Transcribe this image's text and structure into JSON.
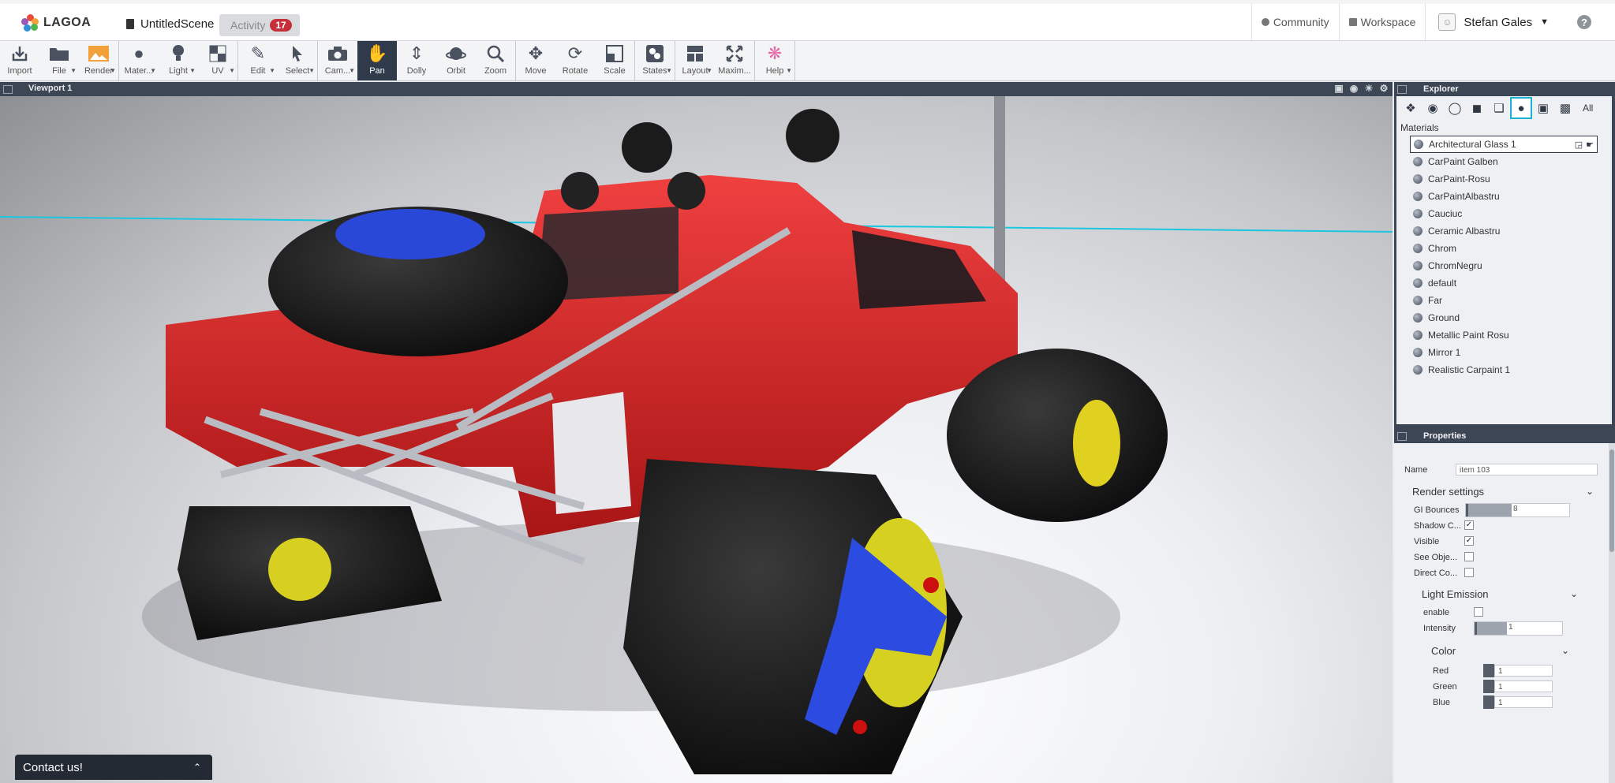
{
  "app": {
    "logo_text": "LAGOA",
    "scene_name": "UntitledScene",
    "activity_label": "Activity",
    "activity_count": "17"
  },
  "topnav": {
    "community": "Community",
    "workspace": "Workspace",
    "user_name": "Stefan Gales",
    "help": "?"
  },
  "toolbar": [
    {
      "id": "import",
      "label": "Import",
      "icon": "import-icon"
    },
    {
      "id": "file",
      "label": "File",
      "icon": "folder-icon"
    },
    {
      "id": "render",
      "label": "Render",
      "icon": "render-icon"
    },
    {
      "id": "material",
      "label": "Mater...",
      "icon": "material-icon"
    },
    {
      "id": "light",
      "label": "Light",
      "icon": "light-icon"
    },
    {
      "id": "uv",
      "label": "UV",
      "icon": "uv-icon"
    },
    {
      "id": "edit",
      "label": "Edit",
      "icon": "edit-icon"
    },
    {
      "id": "select",
      "label": "Select",
      "icon": "select-icon"
    },
    {
      "id": "camera",
      "label": "Cam...",
      "icon": "camera-icon"
    },
    {
      "id": "pan",
      "label": "Pan",
      "icon": "pan-icon"
    },
    {
      "id": "dolly",
      "label": "Dolly",
      "icon": "dolly-icon"
    },
    {
      "id": "orbit",
      "label": "Orbit",
      "icon": "orbit-icon"
    },
    {
      "id": "zoom",
      "label": "Zoom",
      "icon": "zoom-icon"
    },
    {
      "id": "move",
      "label": "Move",
      "icon": "move-icon"
    },
    {
      "id": "rotate",
      "label": "Rotate",
      "icon": "rotate-icon"
    },
    {
      "id": "scale",
      "label": "Scale",
      "icon": "scale-icon"
    },
    {
      "id": "states",
      "label": "States",
      "icon": "states-icon"
    },
    {
      "id": "layout",
      "label": "Layout",
      "icon": "layout-icon"
    },
    {
      "id": "maximize",
      "label": "Maxim...",
      "icon": "maximize-icon"
    },
    {
      "id": "help",
      "label": "Help",
      "icon": "help-icon"
    }
  ],
  "viewport": {
    "title": "Viewport 1"
  },
  "explorer": {
    "title": "Explorer",
    "filter_all": "All",
    "list_title": "Materials",
    "materials": [
      "Architectural Glass 1",
      "CarPaint Galben",
      "CarPaint-Rosu",
      "CarPaintAlbastru",
      "Cauciuc",
      "Ceramic Albastru",
      "Chrom",
      "ChromNegru",
      "default",
      "Far",
      "Ground",
      "Metallic Paint Rosu",
      "Mirror 1",
      "Realistic Carpaint 1"
    ]
  },
  "properties": {
    "title": "Properties",
    "name_label": "Name",
    "name_value": "item 103",
    "render_settings": "Render settings",
    "gi_bounces_label": "GI Bounces",
    "gi_bounces_value": "8",
    "shadow_label": "Shadow C...",
    "shadow_checked": true,
    "visible_label": "Visible",
    "visible_checked": true,
    "see_objects_label": "See Obje...",
    "see_objects_checked": false,
    "direct_label": "Direct Co...",
    "direct_checked": false,
    "light_emission": "Light Emission",
    "enable_label": "enable",
    "enable_checked": false,
    "intensity_label": "Intensity",
    "intensity_value": "1",
    "color_section": "Color",
    "red_label": "Red",
    "red_value": "1",
    "green_label": "Green",
    "green_value": "1",
    "blue_label": "Blue",
    "blue_value": "1"
  },
  "contact": {
    "label": "Contact us!"
  },
  "colors": {
    "accent": "#19b3d6",
    "panel": "#3d4654",
    "active_tool": "#2f3b4b",
    "badge": "#c7303a",
    "car_red": "#d42525"
  }
}
